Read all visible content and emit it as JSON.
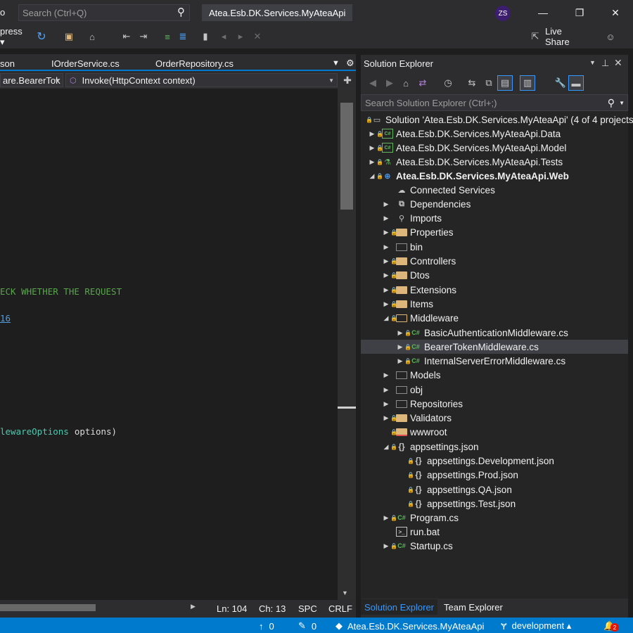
{
  "titlebar": {
    "menu_partial": "o",
    "search_placeholder": "Search (Ctrl+Q)",
    "project_title": "Atea.Esb.DK.Services.MyAteaApi",
    "avatar_initials": "ZS",
    "minimize": "—",
    "restore": "❐",
    "close": "✕"
  },
  "toolbar": {
    "express_label": "press ▾",
    "live_share": "Live Share"
  },
  "doctabs": {
    "tab_partial": "son",
    "tab2": "IOrderService.cs",
    "tab3": "OrderRepository.cs"
  },
  "navbar": {
    "class_selector": "are.BearerTok",
    "method_selector": "Invoke(HttpContext context)"
  },
  "editor": {
    "comment_line": "ECK WHETHER THE REQUEST",
    "link_line": "16",
    "code_line_a": "lewareOptions",
    "code_line_b": "options)"
  },
  "editor_status": {
    "line": "Ln: 104",
    "col": "Ch: 13",
    "spc": "SPC",
    "crlf": "CRLF"
  },
  "solution_explorer": {
    "title": "Solution Explorer",
    "search_placeholder": "Search Solution Explorer (Ctrl+;)",
    "solution": "Solution 'Atea.Esb.DK.Services.MyAteaApi' (4 of 4 projects)",
    "items": [
      {
        "label": "Atea.Esb.DK.Services.MyAteaApi.Data"
      },
      {
        "label": "Atea.Esb.DK.Services.MyAteaApi.Model"
      },
      {
        "label": "Atea.Esb.DK.Services.MyAteaApi.Tests"
      },
      {
        "label": "Atea.Esb.DK.Services.MyAteaApi.Web"
      },
      {
        "label": "Connected Services"
      },
      {
        "label": "Dependencies"
      },
      {
        "label": "Imports"
      },
      {
        "label": "Properties"
      },
      {
        "label": "bin"
      },
      {
        "label": "Controllers"
      },
      {
        "label": "Dtos"
      },
      {
        "label": "Extensions"
      },
      {
        "label": "Items"
      },
      {
        "label": "Middleware"
      },
      {
        "label": "BasicAuthenticationMiddleware.cs"
      },
      {
        "label": "BearerTokenMiddleware.cs"
      },
      {
        "label": "InternalServerErrorMiddleware.cs"
      },
      {
        "label": "Models"
      },
      {
        "label": "obj"
      },
      {
        "label": "Repositories"
      },
      {
        "label": "Validators"
      },
      {
        "label": "wwwroot"
      },
      {
        "label": "appsettings.json"
      },
      {
        "label": "appsettings.Development.json"
      },
      {
        "label": "appsettings.Prod.json"
      },
      {
        "label": "appsettings.QA.json"
      },
      {
        "label": "appsettings.Test.json"
      },
      {
        "label": "Program.cs"
      },
      {
        "label": "run.bat"
      },
      {
        "label": "Startup.cs"
      }
    ],
    "tab_active": "Solution Explorer",
    "tab_other": "Team Explorer"
  },
  "statusbar": {
    "up_count": "0",
    "edit_count": "0",
    "repo": "Atea.Esb.DK.Services.MyAteaApi",
    "branch": "development ▴",
    "notif_count": "2"
  },
  "colors": {
    "accent": "#007acc",
    "comment": "#57a64a",
    "link": "#569cd6"
  }
}
